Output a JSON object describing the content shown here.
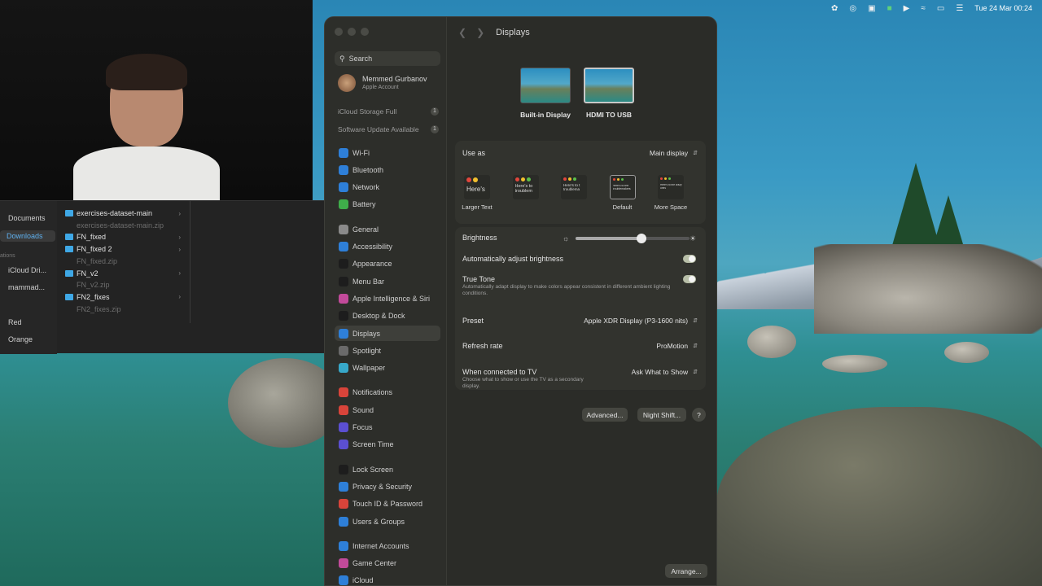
{
  "menubar": {
    "clock": "Tue 24 Mar  00:24",
    "icons": [
      "leaf-icon",
      "creative-cloud-icon",
      "notion-icon",
      "facetime-icon",
      "play-icon",
      "wifi-icon",
      "battery-icon",
      "control-center-icon"
    ]
  },
  "finder": {
    "sidebar": [
      "Documents",
      "Downloads",
      "iCloud Dri...",
      "mammad...",
      "Red",
      "Orange"
    ],
    "sidebar_section": "ations",
    "files": [
      {
        "name": "exercises-dataset-main",
        "folder": true,
        "dim": false
      },
      {
        "name": "exercises-dataset-main.zip",
        "folder": false,
        "dim": true
      },
      {
        "name": "FN_fixed",
        "folder": true,
        "dim": false
      },
      {
        "name": "FN_fixed 2",
        "folder": true,
        "dim": false
      },
      {
        "name": "FN_fixed.zip",
        "folder": false,
        "dim": true
      },
      {
        "name": "FN_v2",
        "folder": true,
        "dim": false
      },
      {
        "name": "FN_v2.zip",
        "folder": false,
        "dim": true
      },
      {
        "name": "FN2_fixes",
        "folder": true,
        "dim": false
      },
      {
        "name": "FN2_fixes.zip",
        "folder": false,
        "dim": true
      }
    ]
  },
  "settings": {
    "window_title": "Displays",
    "search_placeholder": "Search",
    "account": {
      "name": "Memmed Gurbanov",
      "sub": "Apple Account"
    },
    "notices": [
      {
        "label": "iCloud Storage Full",
        "count": "1"
      },
      {
        "label": "Software Update Available",
        "count": "1"
      }
    ],
    "nav": [
      {
        "label": "Wi-Fi",
        "color": "#2e7fd8"
      },
      {
        "label": "Bluetooth",
        "color": "#2e7fd8"
      },
      {
        "label": "Network",
        "color": "#2e7fd8"
      },
      {
        "label": "Battery",
        "color": "#3fae4a"
      },
      {
        "label": "General",
        "color": "#8a8a8a"
      },
      {
        "label": "Accessibility",
        "color": "#2e7fd8"
      },
      {
        "label": "Appearance",
        "color": "#1d1d1d"
      },
      {
        "label": "Menu Bar",
        "color": "#1d1d1d"
      },
      {
        "label": "Apple Intelligence & Siri",
        "color": "#c24a9a"
      },
      {
        "label": "Desktop & Dock",
        "color": "#1d1d1d"
      },
      {
        "label": "Displays",
        "color": "#2e7fd8"
      },
      {
        "label": "Spotlight",
        "color": "#6a6a6a"
      },
      {
        "label": "Wallpaper",
        "color": "#37a8c9"
      },
      {
        "label": "Notifications",
        "color": "#d8443a"
      },
      {
        "label": "Sound",
        "color": "#d8443a"
      },
      {
        "label": "Focus",
        "color": "#5b4fd1"
      },
      {
        "label": "Screen Time",
        "color": "#5b4fd1"
      },
      {
        "label": "Lock Screen",
        "color": "#1d1d1d"
      },
      {
        "label": "Privacy & Security",
        "color": "#2e7fd8"
      },
      {
        "label": "Touch ID & Password",
        "color": "#d8443a"
      },
      {
        "label": "Users & Groups",
        "color": "#2e7fd8"
      },
      {
        "label": "Internet Accounts",
        "color": "#2e7fd8"
      },
      {
        "label": "Game Center",
        "color": "#c24a9a"
      },
      {
        "label": "iCloud",
        "color": "#2e7fd8"
      }
    ],
    "selected_nav": "Displays",
    "displays": [
      {
        "label": "Built-in Display",
        "selected": false
      },
      {
        "label": "HDMI TO USB",
        "selected": true
      }
    ],
    "use_as": {
      "label": "Use as",
      "value": "Main display"
    },
    "resolution_options": [
      {
        "label": "Larger Text",
        "preview": "Here's"
      },
      {
        "label": "",
        "preview": "Here's to troublem"
      },
      {
        "label": "",
        "preview": "Here's to t troublema"
      },
      {
        "label": "Default",
        "preview": "Here's to the troublemakers"
      },
      {
        "label": "More Space",
        "preview": "Here's to the crazy ones"
      }
    ],
    "selected_resolution": "Default",
    "brightness": {
      "label": "Brightness",
      "level": 0.58
    },
    "auto_brightness": {
      "label": "Automatically adjust brightness",
      "on": true
    },
    "true_tone": {
      "label": "True Tone",
      "description": "Automatically adapt display to make colors appear consistent in different ambient lighting conditions.",
      "on": true
    },
    "preset": {
      "label": "Preset",
      "value": "Apple XDR Display (P3-1600 nits)"
    },
    "refresh_rate": {
      "label": "Refresh rate",
      "value": "ProMotion"
    },
    "tv": {
      "label": "When connected to TV",
      "description": "Choose what to show or use the TV as a secondary display.",
      "value": "Ask What to Show"
    },
    "buttons": {
      "advanced": "Advanced...",
      "night_shift": "Night Shift...",
      "help": "?",
      "arrange": "Arrange..."
    }
  }
}
